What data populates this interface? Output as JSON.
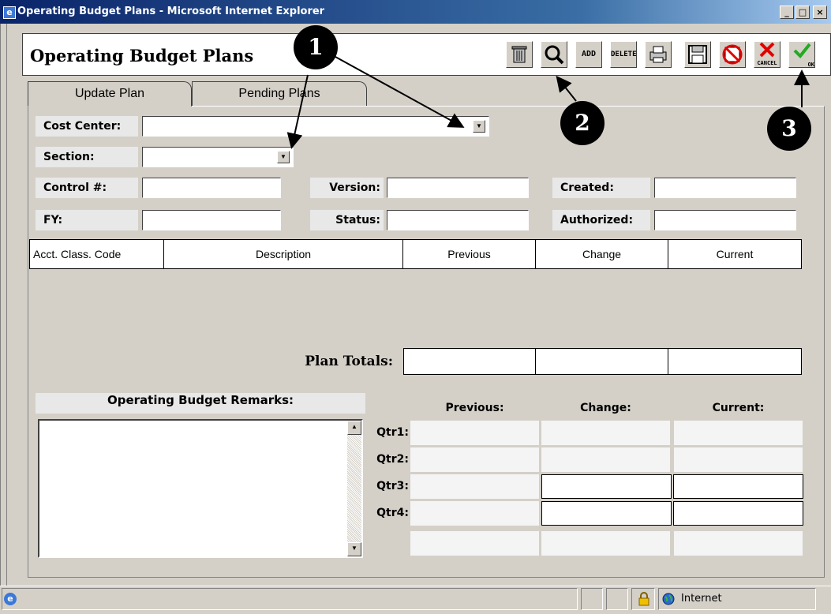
{
  "window": {
    "title": "Operating Budget Plans - Microsoft Internet Explorer",
    "controls": [
      "_",
      "□",
      "×"
    ]
  },
  "header": {
    "title": "Operating Budget Plans"
  },
  "toolbar": {
    "trash_icon": "trash-icon",
    "search_icon": "search-icon",
    "add_label": "ADD",
    "delete_label": "DELETE",
    "print_icon": "printer-icon",
    "save_icon": "save-icon",
    "cancel_label": "CANCEL",
    "ok_label": "OK"
  },
  "tabs": [
    {
      "label": "Update Plan"
    },
    {
      "label": "Pending Plans"
    }
  ],
  "form": {
    "cost_center": "Cost Center:",
    "section": "Section:",
    "control": "Control #:",
    "fy": "FY:",
    "version": "Version:",
    "status": "Status:",
    "created": "Created:",
    "authorized": "Authorized:"
  },
  "grid": {
    "columns": [
      "Acct. Class. Code",
      "Description",
      "Previous",
      "Change",
      "Current"
    ]
  },
  "totals": {
    "label": "Plan Totals:"
  },
  "remarks": {
    "label": "Operating Budget Remarks:"
  },
  "quarters": {
    "headers": [
      "Previous:",
      "Change:",
      "Current:"
    ],
    "rows": [
      "Qtr1:",
      "Qtr2:",
      "Qtr3:",
      "Qtr4:"
    ]
  },
  "statusbar": {
    "zone": "Internet"
  },
  "callouts": [
    "1",
    "2",
    "3"
  ],
  "colors": {
    "titlebar": "#0a246a",
    "face": "#d4d0c8"
  }
}
